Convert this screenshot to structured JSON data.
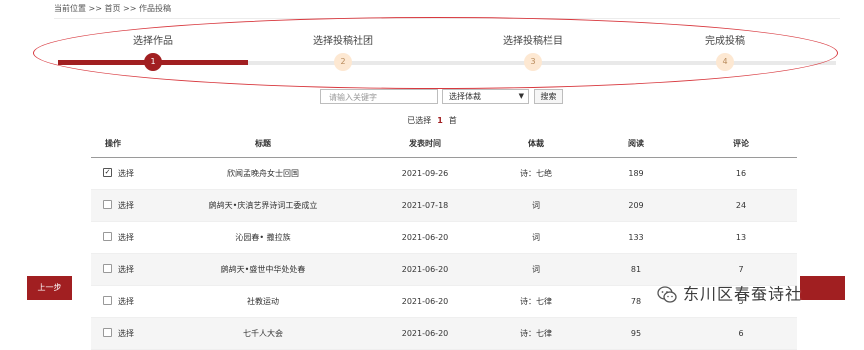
{
  "breadcrumb": "当前位置 >> 首页 >> 作品投稿",
  "steps": [
    {
      "label": "选择作品",
      "num": "1",
      "active": true
    },
    {
      "label": "选择投稿社团",
      "num": "2",
      "active": false
    },
    {
      "label": "选择投稿栏目",
      "num": "3",
      "active": false
    },
    {
      "label": "完成投稿",
      "num": "4",
      "active": false
    }
  ],
  "search": {
    "placeholder": "请输入关键字",
    "genre_selected": "选择体裁",
    "button": "搜索"
  },
  "selected": {
    "prefix": "已选择",
    "count": "1",
    "suffix": "首"
  },
  "table": {
    "headers": [
      "操作",
      "标题",
      "发表时间",
      "体裁",
      "阅读",
      "评论"
    ],
    "rows": [
      {
        "checked": true,
        "action": "选择",
        "title": "欣闻孟晚舟女士回国",
        "date": "2021-09-26",
        "genre": "诗：七绝",
        "reads": "189",
        "comments": "16"
      },
      {
        "checked": false,
        "action": "选择",
        "title": "鹧鸪天•庆滇艺界诗词工委成立",
        "date": "2021-07-18",
        "genre": "词",
        "reads": "209",
        "comments": "24"
      },
      {
        "checked": false,
        "action": "选择",
        "title": "沁园春• 撒拉族",
        "date": "2021-06-20",
        "genre": "词",
        "reads": "133",
        "comments": "13"
      },
      {
        "checked": false,
        "action": "选择",
        "title": "鹧鸪天•盛世中华处处春",
        "date": "2021-06-20",
        "genre": "词",
        "reads": "81",
        "comments": "7"
      },
      {
        "checked": false,
        "action": "选择",
        "title": "社教运动",
        "date": "2021-06-20",
        "genre": "诗：七律",
        "reads": "78",
        "comments": "5"
      },
      {
        "checked": false,
        "action": "选择",
        "title": "七千人大会",
        "date": "2021-06-20",
        "genre": "诗：七律",
        "reads": "95",
        "comments": "6"
      }
    ]
  },
  "prev_button": "上一步",
  "watermark": "东川区春蚕诗社",
  "colors": {
    "accent": "#a11f21",
    "annotation": "#d8393f"
  }
}
